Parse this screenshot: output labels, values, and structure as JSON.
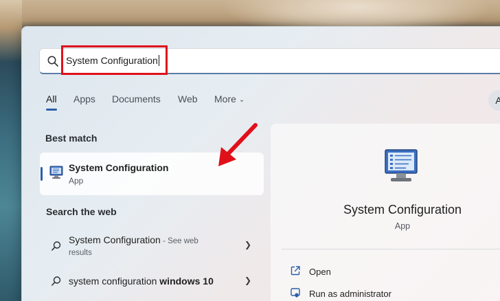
{
  "search": {
    "value": "System Configuration"
  },
  "tabs": [
    {
      "label": "All"
    },
    {
      "label": "Apps"
    },
    {
      "label": "Documents"
    },
    {
      "label": "Web"
    },
    {
      "label": "More"
    }
  ],
  "avatar_initial": "A",
  "best_match": {
    "heading": "Best match",
    "title": "System Configuration",
    "subtitle": "App"
  },
  "search_web": {
    "heading": "Search the web",
    "items": [
      {
        "text": "System Configuration",
        "suffix": " - See web",
        "suffix2": "results"
      },
      {
        "text": "system configuration ",
        "bold": "windows 10"
      }
    ]
  },
  "preview": {
    "title": "System Configuration",
    "subtitle": "App",
    "actions": [
      {
        "label": "Open",
        "icon": "open-external-icon"
      },
      {
        "label": "Run as administrator",
        "icon": "shield-icon"
      }
    ]
  },
  "colors": {
    "accent": "#2b5ea8",
    "highlight": "#e0101a",
    "arrow": "#e0101a"
  }
}
